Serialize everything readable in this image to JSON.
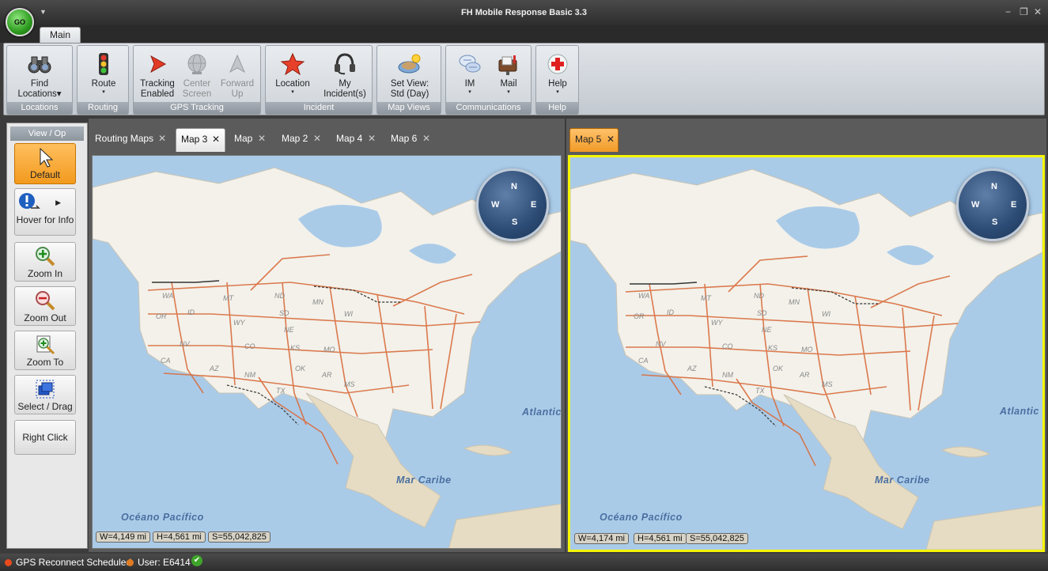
{
  "app": {
    "title": "FH Mobile Response Basic 3.3",
    "orb_label": "GO",
    "qa_arrow": "▼"
  },
  "window": {
    "minimize": "−",
    "restore": "❐",
    "close": "✕"
  },
  "ribbon": {
    "tab": "Main",
    "groups": [
      {
        "label": "Locations",
        "buttons": [
          {
            "line1": "Find",
            "line2": "Locations",
            "caret": "▾",
            "icon": "binoculars-icon"
          }
        ]
      },
      {
        "label": "Routing",
        "buttons": [
          {
            "line1": "Route",
            "line2": "",
            "caret": "▾",
            "icon": "traffic-light-icon"
          }
        ]
      },
      {
        "label": "GPS Tracking",
        "buttons": [
          {
            "line1": "Tracking",
            "line2": "Enabled",
            "icon": "tracking-arrow-icon"
          },
          {
            "line1": "Center",
            "line2": "Screen",
            "icon": "globe-icon",
            "disabled": true
          },
          {
            "line1": "Forward",
            "line2": "Up",
            "icon": "forward-up-icon",
            "disabled": true
          }
        ]
      },
      {
        "label": "Incident",
        "buttons": [
          {
            "line1": "Location",
            "line2": "",
            "caret": "▾",
            "icon": "star-icon"
          },
          {
            "line1": "My",
            "line2": "Incident(s)",
            "icon": "headset-icon"
          }
        ]
      },
      {
        "label": "Map Views",
        "buttons": [
          {
            "line1": "Set View:",
            "line2": "Std (Day)",
            "icon": "map-view-icon"
          }
        ]
      },
      {
        "label": "Communications",
        "buttons": [
          {
            "line1": "IM",
            "line2": "",
            "caret": "▾",
            "icon": "chat-bubbles-icon"
          },
          {
            "line1": "Mail",
            "line2": "",
            "caret": "▾",
            "icon": "mailbox-icon"
          }
        ]
      },
      {
        "label": "Help",
        "buttons": [
          {
            "line1": "Help",
            "line2": "",
            "caret": "▾",
            "icon": "help-cross-icon"
          }
        ]
      }
    ]
  },
  "tools": {
    "header": "View / Op",
    "items": [
      {
        "label": "Default",
        "icon": "cursor-icon",
        "active": true
      },
      {
        "label": "Hover for Info",
        "icon": "info-hover-icon"
      },
      {
        "label": "Zoom In",
        "icon": "zoom-in-icon"
      },
      {
        "label": "Zoom Out",
        "icon": "zoom-out-icon"
      },
      {
        "label": "Zoom To",
        "icon": "zoom-to-icon"
      },
      {
        "label": "Select / Drag",
        "icon": "select-drag-icon"
      },
      {
        "label": "Right Click",
        "icon": ""
      }
    ],
    "submenu_arrow": "▶"
  },
  "left_pane": {
    "tabs": [
      {
        "label": "Routing Maps"
      },
      {
        "label": "Map 3",
        "selected": true
      },
      {
        "label": "Map"
      },
      {
        "label": "Map 2"
      },
      {
        "label": "Map 4"
      },
      {
        "label": "Map 6"
      }
    ],
    "close_glyph": "✕",
    "status": {
      "w": "W=4,149 mi",
      "h": "H=4,561 mi",
      "s": "S=55,042,825"
    }
  },
  "right_pane": {
    "tabs": [
      {
        "label": "Map 5",
        "selected": true
      }
    ],
    "status": {
      "w": "W=4,174 mi",
      "h": "H=4,561 mi",
      "s": "S=55,042,825"
    }
  },
  "map_labels": {
    "atlantic": "Atlantic",
    "caribe": "Mar Caribe",
    "pacifico": "Océano Pacífico"
  },
  "state_labels": [
    "WA",
    "MT",
    "ND",
    "MN",
    "OR",
    "ID",
    "WY",
    "SD",
    "NE",
    "WI",
    "NV",
    "CO",
    "KS",
    "MO",
    "CA",
    "AZ",
    "NM",
    "OK",
    "AR",
    "TX",
    "MS"
  ],
  "compass": {
    "n": "N",
    "s": "S",
    "e": "E",
    "w": "W"
  },
  "statusbar": {
    "gps": "GPS Reconnect Scheduled",
    "user": "User: E6414",
    "ok": "✔"
  },
  "colors": {
    "accent_orange": "#f29a1e",
    "selected_map_border": "#f5f500",
    "road": "#d96d3d",
    "water": "#aacbe8",
    "land": "#f3f1ea"
  }
}
